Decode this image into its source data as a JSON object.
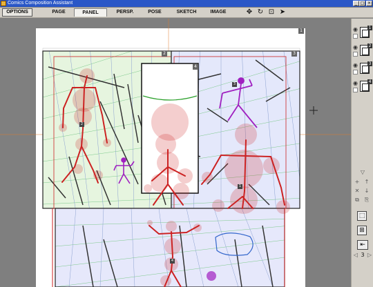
{
  "window": {
    "title": "Comics Composition Assistant",
    "buttons": {
      "minimize": "_",
      "maximize": "□",
      "close": "×"
    }
  },
  "toolbar": {
    "options_label": "OPTIONS",
    "tabs": [
      {
        "label": "PAGE"
      },
      {
        "label": "PANEL",
        "active": true
      },
      {
        "label": "PERSP."
      },
      {
        "label": "POSE"
      },
      {
        "label": "SKETCH"
      },
      {
        "label": "IMAGE"
      }
    ],
    "tools": [
      {
        "icon": "move-icon",
        "glyph": "✥"
      },
      {
        "icon": "rotate-icon",
        "glyph": "↻"
      },
      {
        "icon": "stamp-icon",
        "glyph": "⊡"
      },
      {
        "icon": "pointer-icon",
        "glyph": "➤"
      }
    ]
  },
  "canvas": {
    "page_badge": "1",
    "panel_badges": [
      "2",
      "3",
      "4"
    ],
    "figure_badges": [
      "2",
      "3",
      "1",
      "4"
    ],
    "colors": {
      "panel_green": "#e6f5df",
      "panel_blue": "#e4e8fb",
      "figure_red": "#cc2222",
      "figure_purple": "#a020c0",
      "outline_blue": "#3366cc",
      "arc_green": "#2aa02a"
    }
  },
  "layers": {
    "items": [
      {
        "number": "1",
        "icon": "eye-icon"
      },
      {
        "number": "2",
        "icon": "eye-icon"
      },
      {
        "number": "3",
        "icon": "eye-icon"
      },
      {
        "number": "4",
        "icon": "eye-icon"
      }
    ],
    "page_counter": "3"
  }
}
